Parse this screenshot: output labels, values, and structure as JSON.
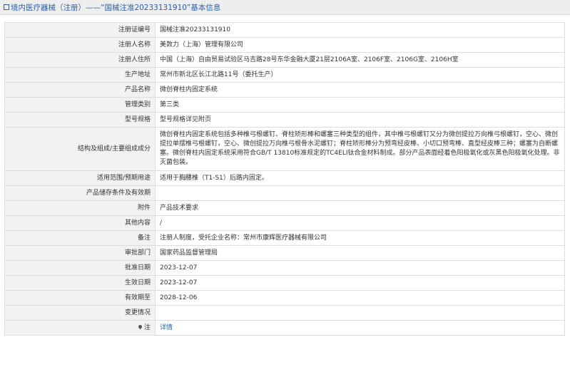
{
  "header": {
    "title": "境内医疗器械（注册）——“国械注准20233131910”基本信息"
  },
  "rows": [
    {
      "label": "注册证编号",
      "value": "国械注准20233131910"
    },
    {
      "label": "注册人名称",
      "value": "美敦力（上海）管理有限公司"
    },
    {
      "label": "注册人住所",
      "value": "中国（上海）自由贸易试验区马吉路28号东华金融大厦21层2106A室、2106F室、2106G室、2106H室"
    },
    {
      "label": "生产地址",
      "value": "常州市新北区长江北路11号（委托生产）"
    },
    {
      "label": "产品名称",
      "value": "微创脊柱内固定系统"
    },
    {
      "label": "管理类别",
      "value": "第三类"
    },
    {
      "label": "型号规格",
      "value": "型号规格详见附页"
    },
    {
      "label": "结构及组成/主要组成成分",
      "value": "微创脊柱内固定系统包括多种椎弓根螺钉、脊柱矫形棒和螺塞三种类型的组件，其中椎弓根螺钉又分为微创提拉万向椎弓根螺钉，空心、微创提拉单摆椎弓根螺钉，空心、微创提拉万向椎弓根骨水泥螺钉；脊柱矫形棒分为预弯经皮棒、小切口预弯棒、直型经皮棒三种；螺塞为自断螺塞。微创脊柱内固定系统采用符合GB/T 13810标准规定的TC4ELI钛合金材料制成。部分产品表面经着色阳极氧化或灰黑色阳极氧化处理。非灭菌包装。"
    },
    {
      "label": "适用范围/预期用途",
      "value": "适用于胸腰椎（T1-S1）后路内固定。"
    },
    {
      "label": "产品储存条件及有效期",
      "value": ""
    },
    {
      "label": "附件",
      "value": "产品技术要求"
    },
    {
      "label": "其他内容",
      "value": "/"
    },
    {
      "label": "备注",
      "value": "注册人制度，受托企业名称：常州市康辉医疗器械有限公司"
    },
    {
      "label": "审批部门",
      "value": "国家药品监督管理局"
    },
    {
      "label": "批准日期",
      "value": "2023-12-07"
    },
    {
      "label": "生效日期",
      "value": "2023-12-07"
    },
    {
      "label": "有效期至",
      "value": "2028-12-06"
    },
    {
      "label": "变更情况",
      "value": ""
    },
    {
      "label": "注",
      "value": "详情"
    }
  ],
  "icons": {
    "note_icon": "map-marker-icon"
  },
  "colors": {
    "header_text": "#2b5fa8",
    "link": "#2b5fa8",
    "label_bg": "#f2f2f2"
  }
}
